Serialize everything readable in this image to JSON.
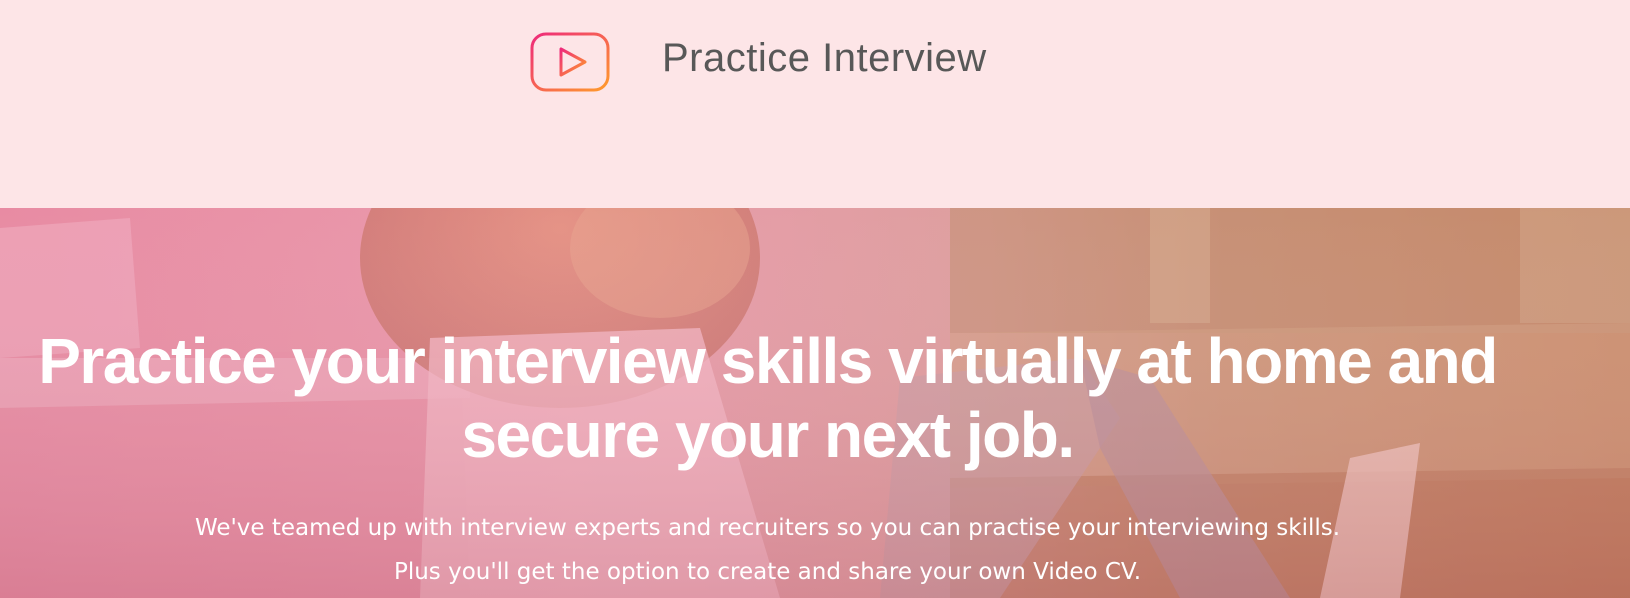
{
  "header": {
    "brand_name": "Practice Interview",
    "logo_icon": "play-icon",
    "colors": {
      "background": "#fde5e7",
      "logo_gradient_start": "#ee2a7b",
      "logo_gradient_end": "#ff9b2b",
      "title": "#585858"
    }
  },
  "hero": {
    "headline_line1": "Practice your interview skills virtually at home and",
    "headline_line2": "secure your next job.",
    "subtext_line1": "We've teamed up with interview experts and recruiters so you can practise your interviewing skills.",
    "subtext_line2": "Plus you'll get the option to create and share your own Video CV.",
    "colors": {
      "overlay_pink": "#e7859e",
      "overlay_orange": "#c47a55",
      "text": "#ffffff"
    }
  }
}
